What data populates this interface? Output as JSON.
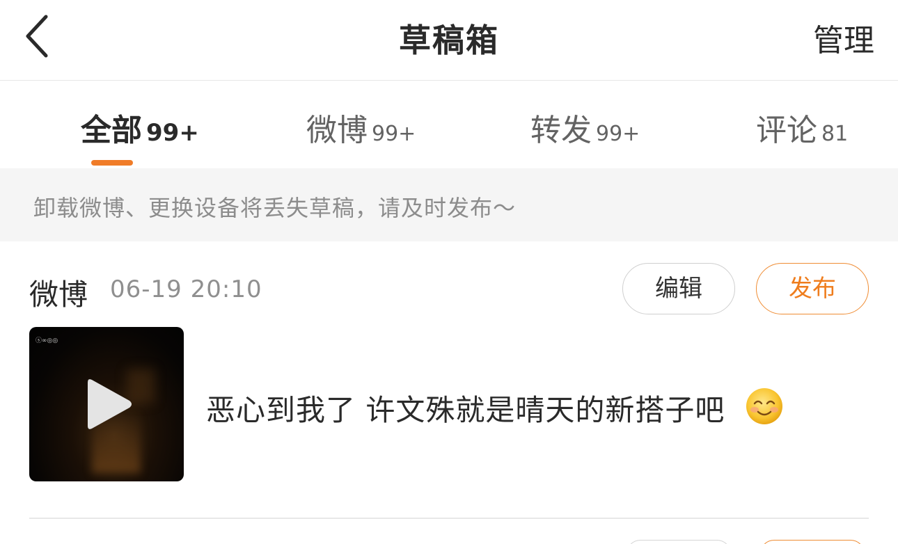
{
  "header": {
    "title": "草稿箱",
    "manage_label": "管理"
  },
  "tabs": [
    {
      "label": "全部",
      "count": "99+",
      "active": true
    },
    {
      "label": "微博",
      "count": "99+",
      "active": false
    },
    {
      "label": "转发",
      "count": "99+",
      "active": false
    },
    {
      "label": "评论",
      "count": "81",
      "active": false
    }
  ],
  "notice": {
    "text": "卸载微博、更换设备将丢失草稿，请及时发布～"
  },
  "drafts": [
    {
      "type": "微博",
      "time": "06-19 20:10",
      "edit_label": "编辑",
      "publish_label": "发布",
      "thumbnail_mark": "ⓢ∞◎◎",
      "content": "恶心到我了 许文殊就是晴天的新搭子吧",
      "emoji": "smile-icon"
    }
  ],
  "colors": {
    "accent": "#f07c28",
    "publish_text": "#ef7d1d",
    "notice_bg": "#f5f5f5"
  }
}
